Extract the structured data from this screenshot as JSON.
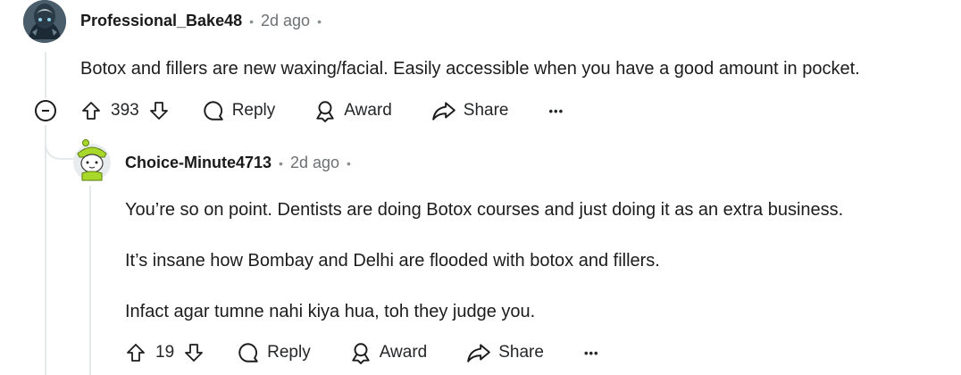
{
  "comment": {
    "author": "Professional_Bake48",
    "time": "2d ago",
    "body": "Botox and fillers are new waxing/facial. Easily accessible when you have a good amount in pocket.",
    "score": "393",
    "reply_label": "Reply",
    "award_label": "Award",
    "share_label": "Share",
    "more_label": "•••"
  },
  "reply": {
    "author": "Choice-Minute4713",
    "time": "2d ago",
    "paragraphs": [
      "You’re so on point. Dentists are doing Botox courses and just doing it as an extra business.",
      "It’s insane how Bombay and Delhi are flooded with botox and fillers.",
      "Infact agar tumne nahi kiya hua, toh they judge you."
    ],
    "score": "19",
    "reply_label": "Reply",
    "award_label": "Award",
    "share_label": "Share",
    "more_label": "•••"
  },
  "dot": "•"
}
